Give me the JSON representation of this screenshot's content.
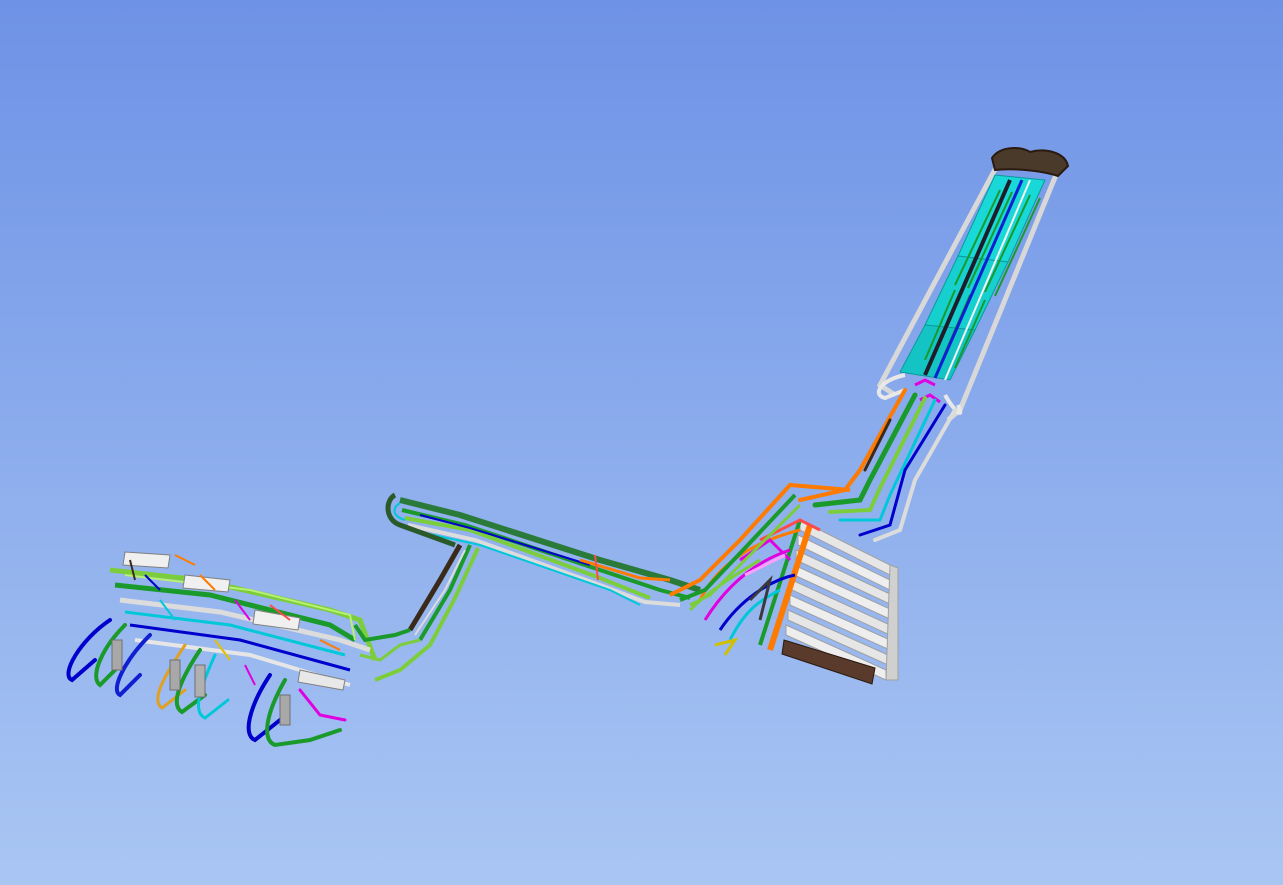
{
  "viewport": {
    "background_top": "#6e92e6",
    "background_bottom": "#a9c6f3"
  },
  "model": {
    "pipe_colors": [
      "#1a9a2a",
      "#7ccd3c",
      "#ff7a00",
      "#0000cc",
      "#00c8d8",
      "#e000e0",
      "#dcdcdc",
      "#3a2a1a",
      "#ffffff",
      "#2a7a3a"
    ]
  }
}
